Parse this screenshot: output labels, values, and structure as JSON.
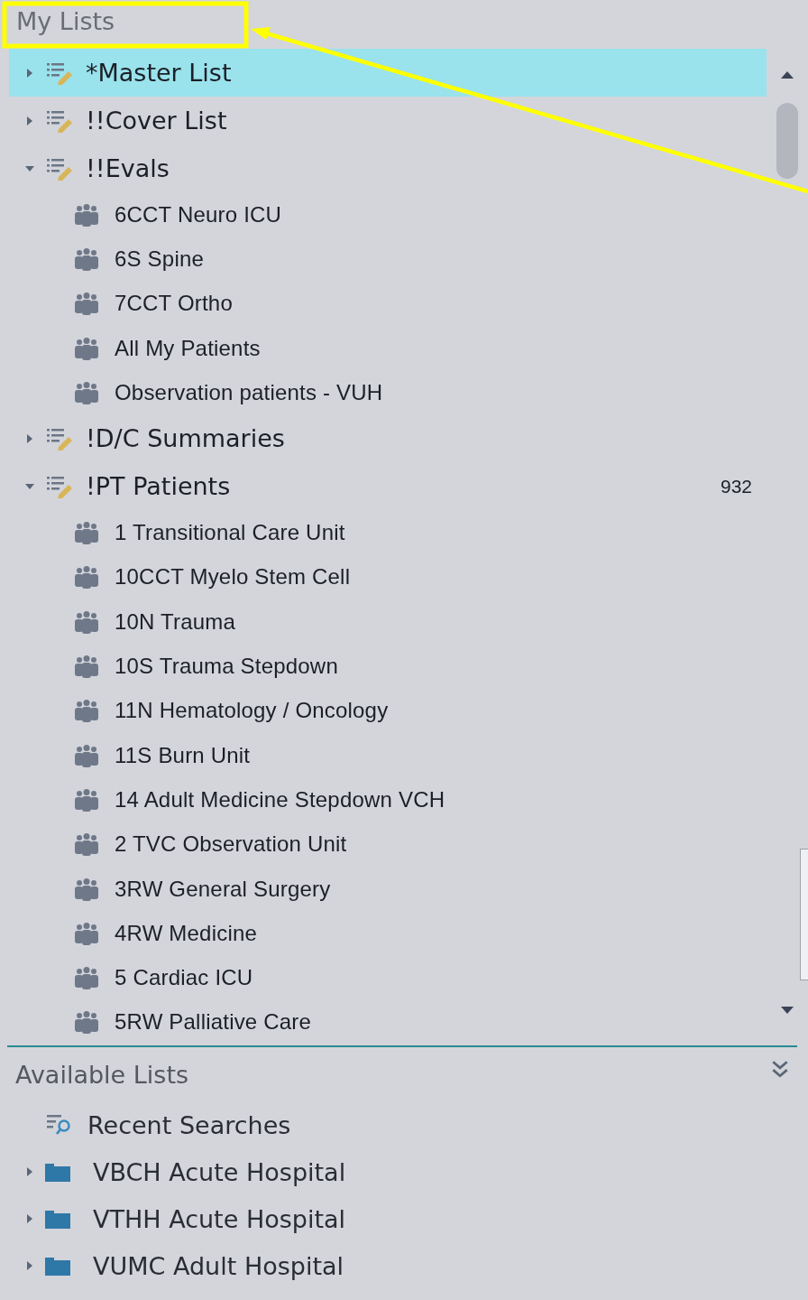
{
  "my_lists": {
    "title": "My Lists",
    "items": [
      {
        "label": "*Master List",
        "selected": true,
        "expanded": false
      },
      {
        "label": "!!Cover List",
        "selected": false,
        "expanded": false
      },
      {
        "label": "!!Evals",
        "selected": false,
        "expanded": true,
        "children": [
          {
            "label": "6CCT Neuro ICU"
          },
          {
            "label": "6S Spine"
          },
          {
            "label": "7CCT Ortho"
          },
          {
            "label": "All My Patients"
          },
          {
            "label": "Observation patients - VUH"
          }
        ]
      },
      {
        "label": "!D/C Summaries",
        "selected": false,
        "expanded": false
      },
      {
        "label": "!PT Patients",
        "selected": false,
        "expanded": true,
        "count": "932",
        "children": [
          {
            "label": "1 Transitional Care Unit"
          },
          {
            "label": "10CCT Myelo Stem Cell"
          },
          {
            "label": "10N Trauma"
          },
          {
            "label": "10S Trauma Stepdown"
          },
          {
            "label": "11N Hematology / Oncology"
          },
          {
            "label": "11S Burn Unit"
          },
          {
            "label": "14 Adult Medicine Stepdown VCH"
          },
          {
            "label": "2 TVC Observation Unit"
          },
          {
            "label": "3RW General Surgery"
          },
          {
            "label": "4RW Medicine"
          },
          {
            "label": "5 Cardiac ICU"
          },
          {
            "label": "5RW Palliative Care"
          }
        ]
      }
    ]
  },
  "available_lists": {
    "title": "Available Lists",
    "items": [
      {
        "kind": "search",
        "label": "Recent Searches"
      },
      {
        "kind": "folder",
        "label": "VBCH Acute Hospital",
        "expanded": false
      },
      {
        "kind": "folder",
        "label": "VTHH Acute Hospital",
        "expanded": false
      },
      {
        "kind": "folder",
        "label": "VUMC Adult Hospital",
        "expanded": false
      }
    ]
  }
}
